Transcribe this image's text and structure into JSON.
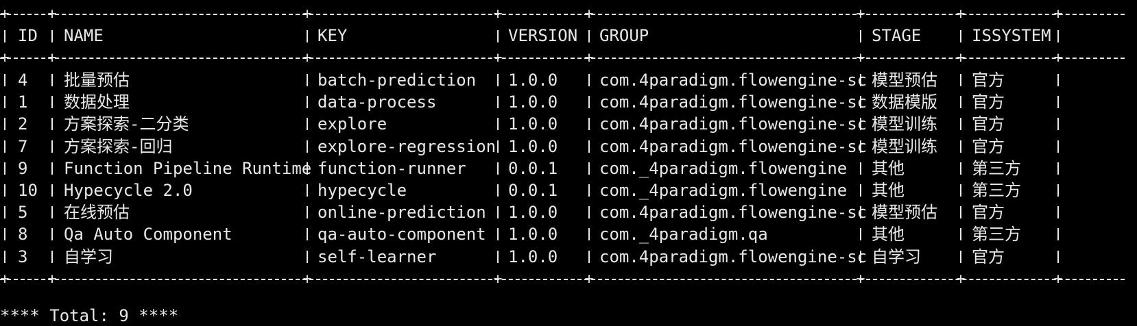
{
  "terminal": {
    "columns": [
      {
        "key": "id",
        "label": "ID"
      },
      {
        "key": "name",
        "label": "NAME"
      },
      {
        "key": "key",
        "label": "KEY"
      },
      {
        "key": "version",
        "label": "VERSION"
      },
      {
        "key": "group",
        "label": "GROUP"
      },
      {
        "key": "stage",
        "label": "STAGE"
      },
      {
        "key": "issystem",
        "label": "ISSYSTEM"
      }
    ],
    "rows": [
      {
        "id": "4",
        "name": "批量预估",
        "key": "batch-prediction",
        "version": "1.0.0",
        "group": "com.4paradigm.flowengine-sc",
        "stage": "模型预估",
        "issystem": "官方"
      },
      {
        "id": "1",
        "name": "数据处理",
        "key": "data-process",
        "version": "1.0.0",
        "group": "com.4paradigm.flowengine-sc",
        "stage": "数据模版",
        "issystem": "官方"
      },
      {
        "id": "2",
        "name": "方案探索-二分类",
        "key": "explore",
        "version": "1.0.0",
        "group": "com.4paradigm.flowengine-sc",
        "stage": "模型训练",
        "issystem": "官方"
      },
      {
        "id": "7",
        "name": "方案探索-回归",
        "key": "explore-regression",
        "version": "1.0.0",
        "group": "com.4paradigm.flowengine-sc",
        "stage": "模型训练",
        "issystem": "官方"
      },
      {
        "id": "9",
        "name": "Function Pipeline Runtime",
        "key": "function-runner",
        "version": "0.0.1",
        "group": "com._4paradigm.flowengine",
        "stage": "其他",
        "issystem": "第三方"
      },
      {
        "id": "10",
        "name": "Hypecycle 2.0",
        "key": "hypecycle",
        "version": "0.0.1",
        "group": "com._4paradigm.flowengine",
        "stage": "其他",
        "issystem": "第三方"
      },
      {
        "id": "5",
        "name": "在线预估",
        "key": "online-prediction",
        "version": "1.0.0",
        "group": "com.4paradigm.flowengine-sc",
        "stage": "模型预估",
        "issystem": "官方"
      },
      {
        "id": "8",
        "name": "Qa Auto Component",
        "key": "qa-auto-component",
        "version": "1.0.0",
        "group": "com._4paradigm.qa",
        "stage": "其他",
        "issystem": "第三方"
      },
      {
        "id": "3",
        "name": "自学习",
        "key": "self-learner",
        "version": "1.0.0",
        "group": "com.4paradigm.flowengine-sc",
        "stage": "自学习",
        "issystem": "官方"
      }
    ],
    "footer": "**** Total: 9 ****"
  }
}
